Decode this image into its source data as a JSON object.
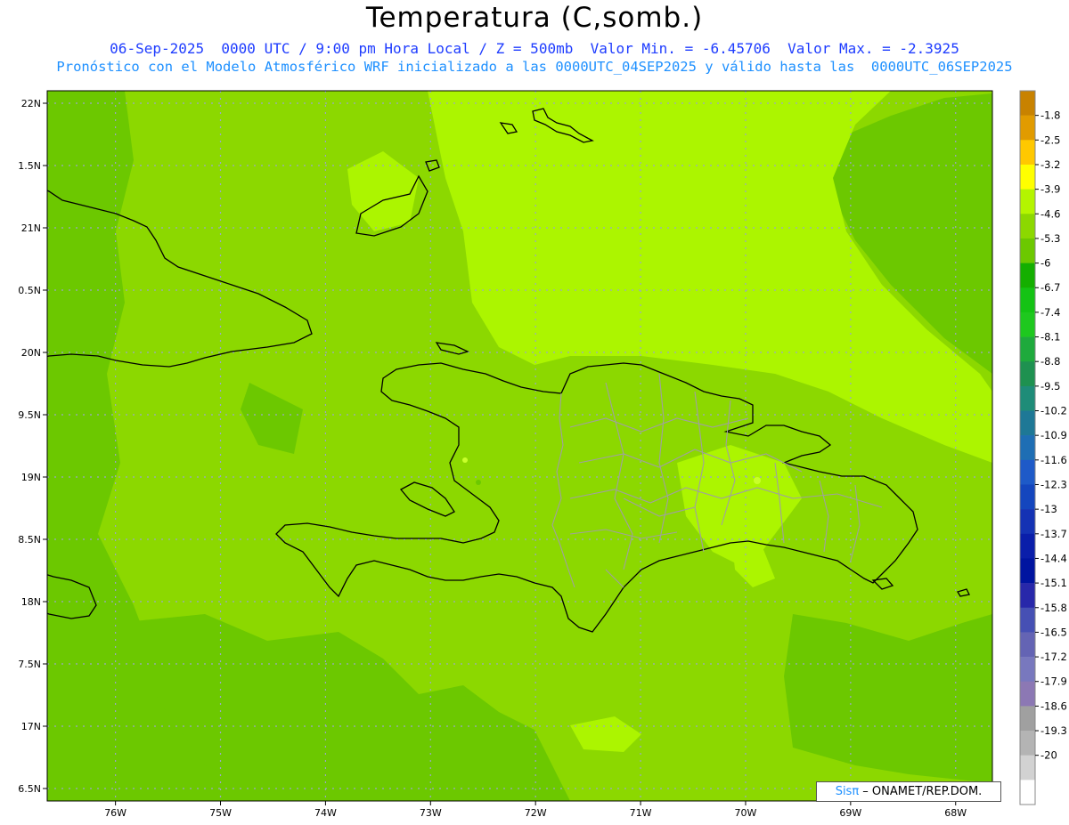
{
  "header": {
    "title": "Temperatura (C,somb.)",
    "line1": "06-Sep-2025  0000 UTC / 9:00 pm Hora Local / Z = 500mb  Valor Min. = -6.45706  Valor Max. = -2.3925",
    "line2": "Pronóstico con el Modelo Atmosférico WRF inicializado a las 0000UTC_04SEP2025 y válido hasta las  0000UTC_06SEP2025"
  },
  "map": {
    "lon_range": [
      -76.65,
      -67.65
    ],
    "lat_range": [
      16.4,
      22.1
    ],
    "lon_ticks": [
      {
        "value": -76,
        "label": "76W"
      },
      {
        "value": -75,
        "label": "75W"
      },
      {
        "value": -74,
        "label": "74W"
      },
      {
        "value": -73,
        "label": "73W"
      },
      {
        "value": -72,
        "label": "72W"
      },
      {
        "value": -71,
        "label": "71W"
      },
      {
        "value": -70,
        "label": "70W"
      },
      {
        "value": -69,
        "label": "69W"
      },
      {
        "value": -68,
        "label": "68W"
      }
    ],
    "lat_ticks": [
      {
        "value": 22,
        "label": "22N"
      },
      {
        "value": 21.5,
        "label": "1.5N"
      },
      {
        "value": 21,
        "label": "21N"
      },
      {
        "value": 20.5,
        "label": "0.5N"
      },
      {
        "value": 20,
        "label": "20N"
      },
      {
        "value": 19.5,
        "label": "9.5N"
      },
      {
        "value": 19,
        "label": "19N"
      },
      {
        "value": 18.5,
        "label": "8.5N"
      },
      {
        "value": 18,
        "label": "18N"
      },
      {
        "value": 17.5,
        "label": "7.5N"
      },
      {
        "value": 17,
        "label": "17N"
      },
      {
        "value": 16.5,
        "label": "6.5N"
      }
    ],
    "colors": {
      "dark_green": "#6cc800",
      "mid_green": "#8cd800",
      "light_green": "#acf500",
      "yellow_green": "#c8ff2a",
      "coast": "#000000",
      "border": "#a0a0a0",
      "grid": "#9aa6c8"
    }
  },
  "colorbar": {
    "labels": [
      "-1.8",
      "-2.5",
      "-3.2",
      "-3.9",
      "-4.6",
      "-5.3",
      "-6",
      "-6.7",
      "-7.4",
      "-8.1",
      "-8.8",
      "-9.5",
      "-10.2",
      "-10.9",
      "-11.6",
      "-12.3",
      "-13",
      "-13.7",
      "-14.4",
      "-15.1",
      "-15.8",
      "-16.5",
      "-17.2",
      "-17.9",
      "-18.6",
      "-19.3",
      "-20"
    ],
    "colors": [
      "#c88200",
      "#e19b00",
      "#ffc800",
      "#ffff00",
      "#b4f500",
      "#8cd800",
      "#6cc800",
      "#14af00",
      "#14c314",
      "#1ec81e",
      "#1eaa3c",
      "#1e9150",
      "#1e8c78",
      "#1e7896",
      "#1e6eb4",
      "#1e5ac8",
      "#1446be",
      "#1432b4",
      "#0a1eaa",
      "#0014a0",
      "#2828aa",
      "#4650b4",
      "#6464b4",
      "#7878be",
      "#8c78b4",
      "#a0a0a0",
      "#b4b4b4",
      "#d2d2d2",
      "#ffffff"
    ]
  },
  "credit": {
    "brand": "Sisπ",
    "text": " – ONAMET/REP.DOM."
  }
}
